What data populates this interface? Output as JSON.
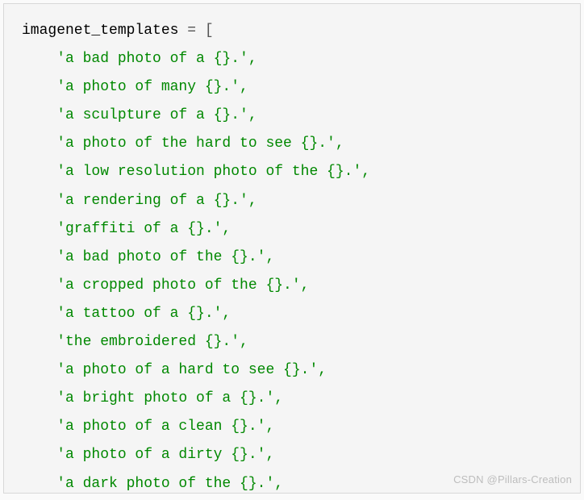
{
  "code": {
    "var_name": "imagenet_templates",
    "assign": "= [",
    "indent": "    ",
    "lines": [
      "'a bad photo of a {}.',",
      "'a photo of many {}.',",
      "'a sculpture of a {}.',",
      "'a photo of the hard to see {}.',",
      "'a low resolution photo of the {}.',",
      "'a rendering of a {}.',",
      "'graffiti of a {}.',",
      "'a bad photo of the {}.',",
      "'a cropped photo of the {}.',",
      "'a tattoo of a {}.',",
      "'the embroidered {}.',",
      "'a photo of a hard to see {}.',",
      "'a bright photo of a {}.',",
      "'a photo of a clean {}.',",
      "'a photo of a dirty {}.',",
      "'a dark photo of the {}.',"
    ]
  },
  "watermark": "CSDN @Pillars-Creation"
}
